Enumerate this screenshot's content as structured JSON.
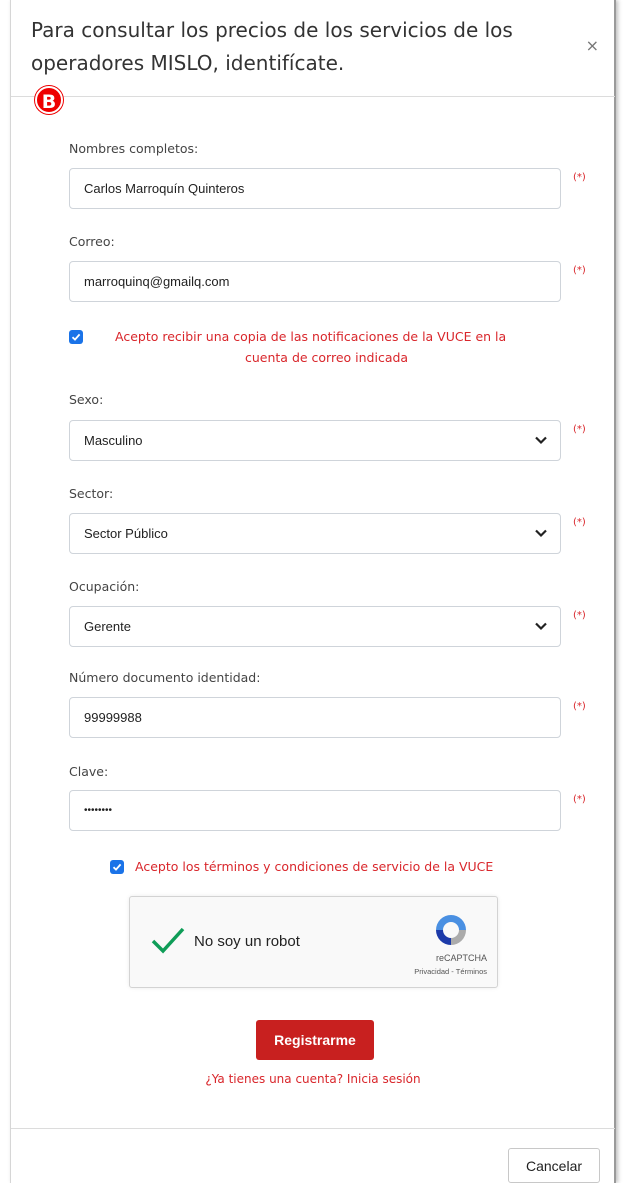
{
  "modal": {
    "title": "Para consultar los precios de los servicios de los operadores MISLO, identifícate.",
    "close_glyph": "×",
    "badge": "B"
  },
  "form": {
    "required_mark": "(*)",
    "nombres": {
      "label": "Nombres completos:",
      "value": "Carlos Marroquín Quinteros"
    },
    "correo": {
      "label": "Correo:",
      "value": "marroquinq@gmailq.com"
    },
    "notif_checkbox": {
      "checked": true,
      "line1": "Acepto recibir una copia de las notificaciones de la VUCE en la",
      "line2": "cuenta de correo indicada"
    },
    "sexo": {
      "label": "Sexo:",
      "value": "Masculino"
    },
    "sector": {
      "label": "Sector:",
      "value": "Sector Público"
    },
    "ocupacion": {
      "label": "Ocupación:",
      "value": "Gerente"
    },
    "documento": {
      "label": "Número documento identidad:",
      "value": "99999988"
    },
    "clave": {
      "label": "Clave:",
      "value": "••••••••"
    },
    "terms_checkbox": {
      "checked": true,
      "label": "Acepto los términos y condiciones de servicio de la VUCE"
    }
  },
  "captcha": {
    "label": "No soy un robot",
    "brand": "reCAPTCHA",
    "links": "Privacidad - Términos"
  },
  "actions": {
    "register": "Registrarme",
    "login_link": "¿Ya tienes una cuenta? Inicia sesión",
    "cancel": "Cancelar"
  },
  "colors": {
    "accent_red": "#c8201f",
    "checkbox_blue": "#1a73e8"
  }
}
